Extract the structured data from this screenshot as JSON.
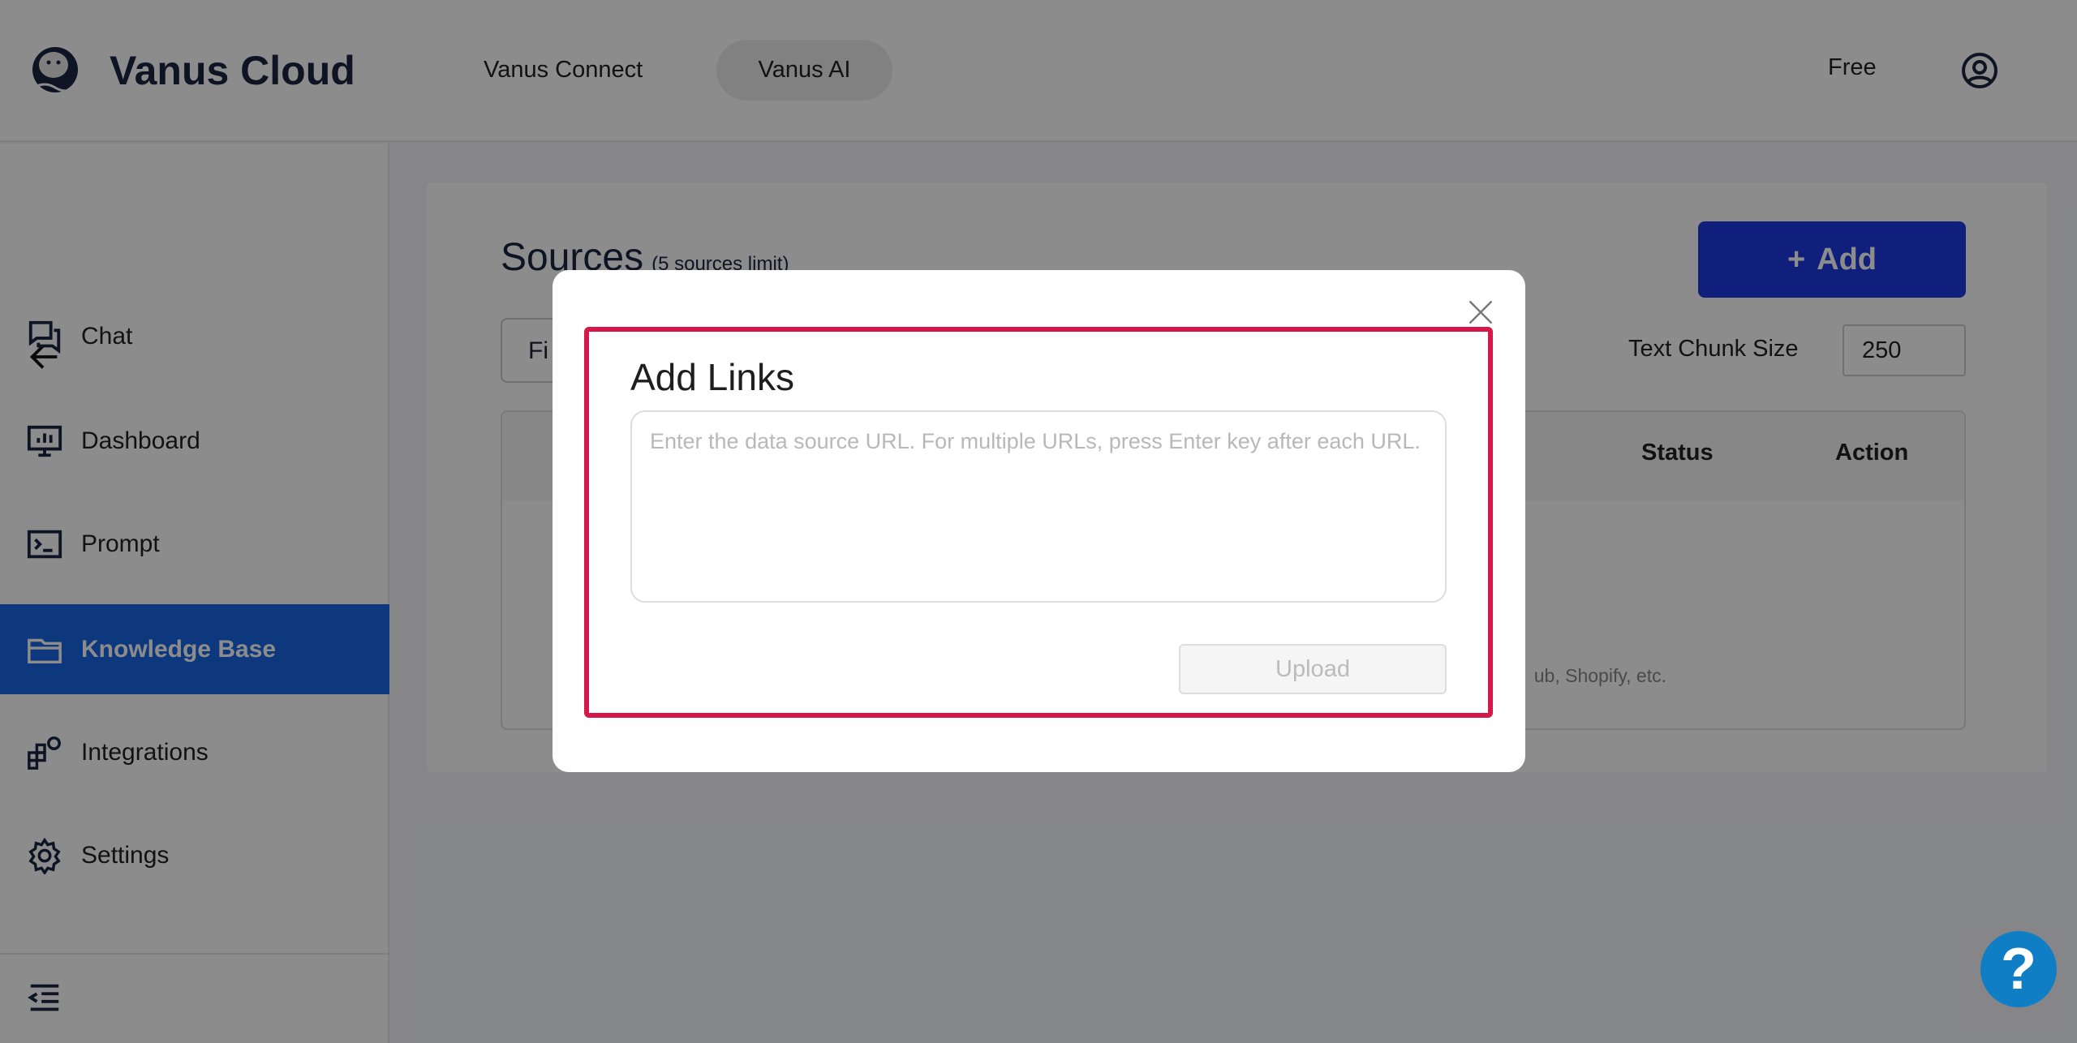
{
  "header": {
    "brand": "Vanus Cloud",
    "nav": [
      {
        "label": "Vanus Connect"
      },
      {
        "label": "Vanus AI",
        "active": true
      }
    ],
    "plan": "Free"
  },
  "sidebar": {
    "items": [
      {
        "label": "Chat",
        "icon": "chat-icon"
      },
      {
        "label": "Dashboard",
        "icon": "dashboard-icon"
      },
      {
        "label": "Prompt",
        "icon": "terminal-icon"
      },
      {
        "label": "Knowledge Base",
        "icon": "folder-icon",
        "active": true
      },
      {
        "label": "Integrations",
        "icon": "integrations-icon"
      },
      {
        "label": "Settings",
        "icon": "gear-icon"
      }
    ]
  },
  "main": {
    "title": "Sources",
    "limit": "(5 sources limit)",
    "add_label": "Add",
    "filter_tab": "Fi",
    "chunk_label": "Text Chunk Size",
    "chunk_value": "250",
    "columns": [
      "Status",
      "Action"
    ],
    "empty_hint": "ub, Shopify, etc."
  },
  "modal": {
    "title": "Add Links",
    "placeholder": "Enter the data source URL. For multiple URLs, press Enter key after each URL.",
    "upload_label": "Upload"
  },
  "help": "?",
  "colors": {
    "accent": "#1c3ae0",
    "active_nav": "#1a66e3",
    "highlight": "#d5174a",
    "help": "#0f7ec4"
  }
}
